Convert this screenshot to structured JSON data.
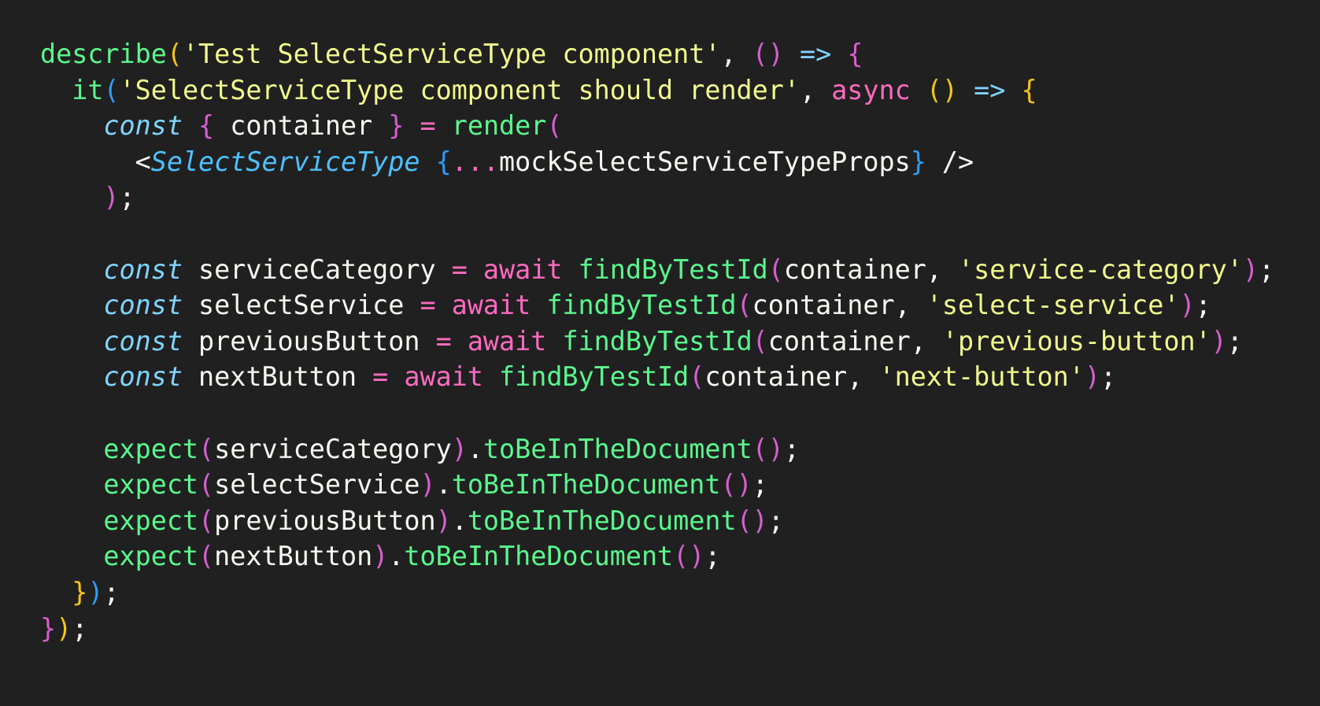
{
  "colors": {
    "background": "#202020",
    "default": "#f8f8f2",
    "function": "#5af78e",
    "string": "#f1fa8c",
    "keyword": "#ff6ac1",
    "storage": "#80d4ff",
    "component": "#4fc1ff",
    "bracket_purple": "#d65fd0",
    "bracket_gold": "#f5c518",
    "bracket_blue": "#2f9cf6"
  },
  "code": {
    "lines": [
      {
        "indent": "",
        "tokens": [
          {
            "t": "describe",
            "c": "function"
          },
          {
            "t": "(",
            "c": "bracket_gold"
          },
          {
            "t": "'Test SelectServiceType component'",
            "c": "string"
          },
          {
            "t": ", ",
            "c": "default"
          },
          {
            "t": "()",
            "c": "bracket_purple"
          },
          {
            "t": " ",
            "c": "default"
          },
          {
            "t": "=>",
            "c": "storage"
          },
          {
            "t": " ",
            "c": "default"
          },
          {
            "t": "{",
            "c": "bracket_purple"
          }
        ]
      },
      {
        "indent": "  ",
        "tokens": [
          {
            "t": "it",
            "c": "function"
          },
          {
            "t": "(",
            "c": "bracket_blue"
          },
          {
            "t": "'SelectServiceType component should render'",
            "c": "string"
          },
          {
            "t": ", ",
            "c": "default"
          },
          {
            "t": "async",
            "c": "keyword"
          },
          {
            "t": " ",
            "c": "default"
          },
          {
            "t": "()",
            "c": "bracket_gold"
          },
          {
            "t": " ",
            "c": "default"
          },
          {
            "t": "=>",
            "c": "storage"
          },
          {
            "t": " ",
            "c": "default"
          },
          {
            "t": "{",
            "c": "bracket_gold"
          }
        ]
      },
      {
        "indent": "    ",
        "tokens": [
          {
            "t": "const",
            "c": "storage",
            "italic": true
          },
          {
            "t": " ",
            "c": "default"
          },
          {
            "t": "{",
            "c": "bracket_purple"
          },
          {
            "t": " container ",
            "c": "default"
          },
          {
            "t": "}",
            "c": "bracket_purple"
          },
          {
            "t": " ",
            "c": "default"
          },
          {
            "t": "=",
            "c": "keyword"
          },
          {
            "t": " ",
            "c": "default"
          },
          {
            "t": "render",
            "c": "function"
          },
          {
            "t": "(",
            "c": "bracket_purple"
          }
        ]
      },
      {
        "indent": "      ",
        "tokens": [
          {
            "t": "<",
            "c": "default"
          },
          {
            "t": "SelectServiceType",
            "c": "component",
            "italic": true
          },
          {
            "t": " ",
            "c": "default"
          },
          {
            "t": "{",
            "c": "bracket_blue"
          },
          {
            "t": "...",
            "c": "keyword"
          },
          {
            "t": "mockSelectServiceTypeProps",
            "c": "default"
          },
          {
            "t": "}",
            "c": "bracket_blue"
          },
          {
            "t": " />",
            "c": "default"
          }
        ]
      },
      {
        "indent": "    ",
        "tokens": [
          {
            "t": ")",
            "c": "bracket_purple"
          },
          {
            "t": ";",
            "c": "default"
          }
        ]
      },
      {
        "indent": "",
        "tokens": []
      },
      {
        "indent": "    ",
        "tokens": [
          {
            "t": "const",
            "c": "storage",
            "italic": true
          },
          {
            "t": " serviceCategory ",
            "c": "default"
          },
          {
            "t": "=",
            "c": "keyword"
          },
          {
            "t": " ",
            "c": "default"
          },
          {
            "t": "await",
            "c": "keyword"
          },
          {
            "t": " ",
            "c": "default"
          },
          {
            "t": "findByTestId",
            "c": "function"
          },
          {
            "t": "(",
            "c": "bracket_purple"
          },
          {
            "t": "container, ",
            "c": "default"
          },
          {
            "t": "'service-category'",
            "c": "string"
          },
          {
            "t": ")",
            "c": "bracket_purple"
          },
          {
            "t": ";",
            "c": "default"
          }
        ]
      },
      {
        "indent": "    ",
        "tokens": [
          {
            "t": "const",
            "c": "storage",
            "italic": true
          },
          {
            "t": " selectService ",
            "c": "default"
          },
          {
            "t": "=",
            "c": "keyword"
          },
          {
            "t": " ",
            "c": "default"
          },
          {
            "t": "await",
            "c": "keyword"
          },
          {
            "t": " ",
            "c": "default"
          },
          {
            "t": "findByTestId",
            "c": "function"
          },
          {
            "t": "(",
            "c": "bracket_purple"
          },
          {
            "t": "container, ",
            "c": "default"
          },
          {
            "t": "'select-service'",
            "c": "string"
          },
          {
            "t": ")",
            "c": "bracket_purple"
          },
          {
            "t": ";",
            "c": "default"
          }
        ]
      },
      {
        "indent": "    ",
        "tokens": [
          {
            "t": "const",
            "c": "storage",
            "italic": true
          },
          {
            "t": " previousButton ",
            "c": "default"
          },
          {
            "t": "=",
            "c": "keyword"
          },
          {
            "t": " ",
            "c": "default"
          },
          {
            "t": "await",
            "c": "keyword"
          },
          {
            "t": " ",
            "c": "default"
          },
          {
            "t": "findByTestId",
            "c": "function"
          },
          {
            "t": "(",
            "c": "bracket_purple"
          },
          {
            "t": "container, ",
            "c": "default"
          },
          {
            "t": "'previous-button'",
            "c": "string"
          },
          {
            "t": ")",
            "c": "bracket_purple"
          },
          {
            "t": ";",
            "c": "default"
          }
        ]
      },
      {
        "indent": "    ",
        "tokens": [
          {
            "t": "const",
            "c": "storage",
            "italic": true
          },
          {
            "t": " nextButton ",
            "c": "default"
          },
          {
            "t": "=",
            "c": "keyword"
          },
          {
            "t": " ",
            "c": "default"
          },
          {
            "t": "await",
            "c": "keyword"
          },
          {
            "t": " ",
            "c": "default"
          },
          {
            "t": "findByTestId",
            "c": "function"
          },
          {
            "t": "(",
            "c": "bracket_purple"
          },
          {
            "t": "container, ",
            "c": "default"
          },
          {
            "t": "'next-button'",
            "c": "string"
          },
          {
            "t": ")",
            "c": "bracket_purple"
          },
          {
            "t": ";",
            "c": "default"
          }
        ]
      },
      {
        "indent": "",
        "tokens": []
      },
      {
        "indent": "    ",
        "tokens": [
          {
            "t": "expect",
            "c": "function"
          },
          {
            "t": "(",
            "c": "bracket_purple"
          },
          {
            "t": "serviceCategory",
            "c": "default"
          },
          {
            "t": ")",
            "c": "bracket_purple"
          },
          {
            "t": ".",
            "c": "default"
          },
          {
            "t": "toBeInTheDocument",
            "c": "function"
          },
          {
            "t": "()",
            "c": "bracket_purple"
          },
          {
            "t": ";",
            "c": "default"
          }
        ]
      },
      {
        "indent": "    ",
        "tokens": [
          {
            "t": "expect",
            "c": "function"
          },
          {
            "t": "(",
            "c": "bracket_purple"
          },
          {
            "t": "selectService",
            "c": "default"
          },
          {
            "t": ")",
            "c": "bracket_purple"
          },
          {
            "t": ".",
            "c": "default"
          },
          {
            "t": "toBeInTheDocument",
            "c": "function"
          },
          {
            "t": "()",
            "c": "bracket_purple"
          },
          {
            "t": ";",
            "c": "default"
          }
        ]
      },
      {
        "indent": "    ",
        "tokens": [
          {
            "t": "expect",
            "c": "function"
          },
          {
            "t": "(",
            "c": "bracket_purple"
          },
          {
            "t": "previousButton",
            "c": "default"
          },
          {
            "t": ")",
            "c": "bracket_purple"
          },
          {
            "t": ".",
            "c": "default"
          },
          {
            "t": "toBeInTheDocument",
            "c": "function"
          },
          {
            "t": "()",
            "c": "bracket_purple"
          },
          {
            "t": ";",
            "c": "default"
          }
        ]
      },
      {
        "indent": "    ",
        "tokens": [
          {
            "t": "expect",
            "c": "function"
          },
          {
            "t": "(",
            "c": "bracket_purple"
          },
          {
            "t": "nextButton",
            "c": "default"
          },
          {
            "t": ")",
            "c": "bracket_purple"
          },
          {
            "t": ".",
            "c": "default"
          },
          {
            "t": "toBeInTheDocument",
            "c": "function"
          },
          {
            "t": "()",
            "c": "bracket_purple"
          },
          {
            "t": ";",
            "c": "default"
          }
        ]
      },
      {
        "indent": "  ",
        "tokens": [
          {
            "t": "}",
            "c": "bracket_gold"
          },
          {
            "t": ")",
            "c": "bracket_blue"
          },
          {
            "t": ";",
            "c": "default"
          }
        ]
      },
      {
        "indent": "",
        "tokens": [
          {
            "t": "}",
            "c": "bracket_purple"
          },
          {
            "t": ")",
            "c": "bracket_gold"
          },
          {
            "t": ";",
            "c": "default"
          }
        ]
      }
    ]
  }
}
